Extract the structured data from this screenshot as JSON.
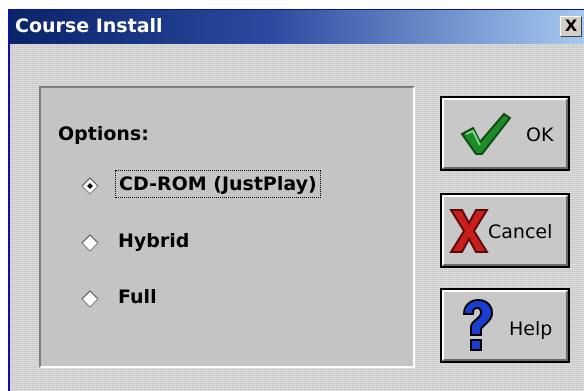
{
  "window": {
    "title": "Course Install",
    "close_glyph": "X"
  },
  "options": {
    "label": "Options:",
    "selected": "CD-ROM (JustPlay)",
    "items": [
      {
        "label": "CD-ROM (JustPlay)",
        "checked": true
      },
      {
        "label": "Hybrid",
        "checked": false
      },
      {
        "label": "Full",
        "checked": false
      }
    ]
  },
  "buttons": {
    "ok": {
      "label": "OK",
      "icon": "checkmark-icon",
      "color": "#1f8a2a"
    },
    "cancel": {
      "label": "Cancel",
      "icon": "red-x-icon",
      "color": "#c81e1e"
    },
    "help": {
      "label": "Help",
      "icon": "question-mark-icon",
      "color": "#1a3fd0"
    }
  }
}
